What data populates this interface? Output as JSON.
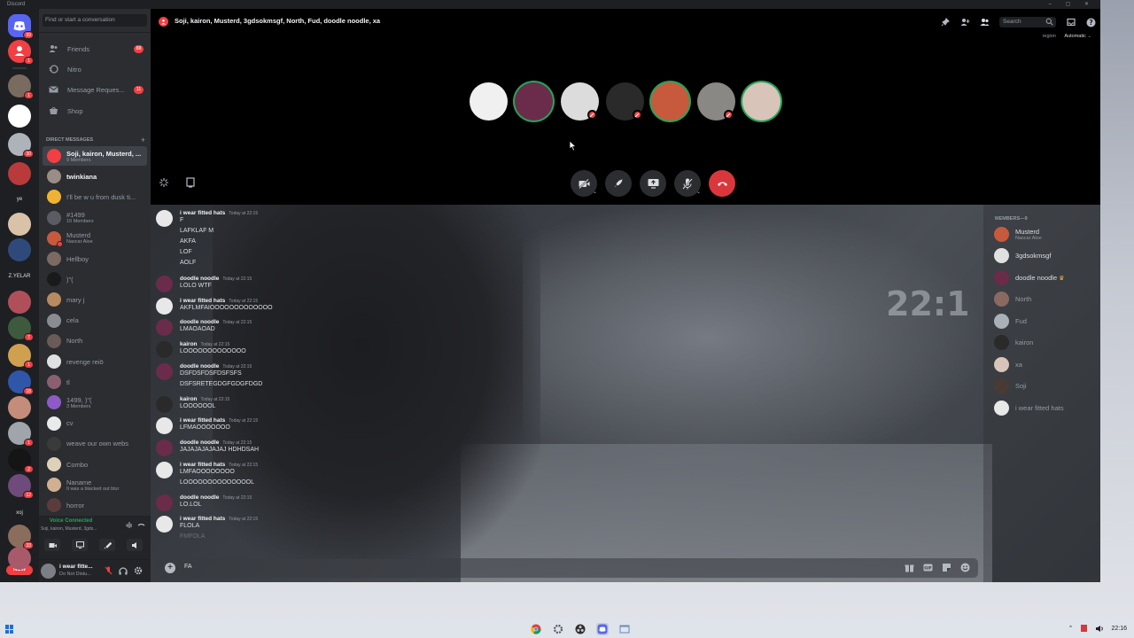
{
  "app": {
    "title": "Discord"
  },
  "rail": {
    "home_badge": "99",
    "dm_badge": "1",
    "items": [
      {
        "label": "",
        "color": "#7a6b60",
        "badge": "1"
      },
      {
        "label": "",
        "color": "#ffffff",
        "badge": ""
      },
      {
        "label": "",
        "color": "#aeb3ba",
        "badge": "30"
      },
      {
        "label": "",
        "color": "#b83a3a",
        "badge": ""
      },
      {
        "label": "ye",
        "color": "#2b2d31",
        "badge": ""
      },
      {
        "label": "",
        "color": "#d9c2a8",
        "badge": ""
      },
      {
        "label": "",
        "color": "#2f4a7a",
        "badge": ""
      },
      {
        "label": "Z.YELAR",
        "color": "#2b2d31",
        "badge": ""
      },
      {
        "label": "",
        "color": "#b04f5a",
        "badge": ""
      },
      {
        "label": "",
        "color": "#3d5a3d",
        "badge": "7"
      },
      {
        "label": "",
        "color": "#cfa050",
        "badge": "1"
      },
      {
        "label": "",
        "color": "#2f56a8",
        "badge": "18"
      },
      {
        "label": "",
        "color": "#c48c7a",
        "badge": ""
      },
      {
        "label": "",
        "color": "#a0a4ab",
        "badge": "1"
      },
      {
        "label": "",
        "color": "#151515",
        "badge": "2"
      },
      {
        "label": "",
        "color": "#6e4b7a",
        "badge": "12"
      },
      {
        "label": "xoj",
        "color": "#2b2d31",
        "badge": ""
      },
      {
        "label": "",
        "color": "#8b6d5e",
        "badge": "33"
      },
      {
        "label": "",
        "color": "#a85a6a",
        "badge": ""
      }
    ],
    "new_label": "NEW"
  },
  "dm": {
    "search_placeholder": "Find or start a conversation",
    "nav": [
      {
        "label": "Friends",
        "icon": "friends-icon",
        "badge": "88"
      },
      {
        "label": "Nitro",
        "icon": "nitro-icon",
        "badge": ""
      },
      {
        "label": "Message Reques...",
        "icon": "message-requests-icon",
        "badge": "11"
      },
      {
        "label": "Shop",
        "icon": "shop-icon",
        "badge": ""
      }
    ],
    "header": "DIRECT MESSAGES",
    "items": [
      {
        "name": "Soji, kairon, Musterd, ...",
        "sub": "9 Members",
        "color": "#f23f43",
        "active": true,
        "status": ""
      },
      {
        "name": "twinkiana",
        "sub": "",
        "color": "#9a8d86",
        "bright": true,
        "status": ""
      },
      {
        "name": "I'll be w u from dusk ti...",
        "sub": "",
        "color": "#f0b232",
        "status": ""
      },
      {
        "name": "#1499",
        "sub": "10 Members",
        "color": "#5a5c63",
        "status": ""
      },
      {
        "name": "Musterd",
        "sub": "Nascar Aloe",
        "color": "#c75a3c",
        "status": "#f23f43"
      },
      {
        "name": "Hellboy",
        "sub": "",
        "color": "#7a6a62",
        "status": ""
      },
      {
        "name": ")\"(",
        "sub": "",
        "color": "#1a1a1a",
        "status": ""
      },
      {
        "name": "mary j",
        "sub": "",
        "color": "#b88a60",
        "status": ""
      },
      {
        "name": "cela",
        "sub": "",
        "color": "#8a8c93",
        "status": ""
      },
      {
        "name": "North",
        "sub": "",
        "color": "#6a5a58",
        "status": ""
      },
      {
        "name": "revenge reiō",
        "sub": "",
        "color": "#e0e0e0",
        "status": ""
      },
      {
        "name": "tl",
        "sub": "",
        "color": "#8a6070",
        "status": ""
      },
      {
        "name": "1499, )\"(",
        "sub": "3 Members",
        "color": "#8e5ac8",
        "status": ""
      },
      {
        "name": "cv",
        "sub": "",
        "color": "#eaeaea",
        "status": ""
      },
      {
        "name": "weave our own webs",
        "sub": "",
        "color": "#3a3a3a",
        "status": ""
      },
      {
        "name": "Combo",
        "sub": "",
        "color": "#ddd2b8",
        "status": ""
      },
      {
        "name": "Naname",
        "sub": "It was a blacked out blur",
        "color": "#d0b090",
        "status": ""
      },
      {
        "name": "horror",
        "sub": "",
        "color": "#5a3c3c",
        "status": ""
      }
    ],
    "voice": {
      "status": "Voice Connected",
      "channel": "Soji, kairon, Musterd, 3gds..."
    },
    "user": {
      "name": "i wear fitte...",
      "status": "Do Not Distu..."
    }
  },
  "main": {
    "title": "Soji, kairon, Musterd, 3gdsokmsgf, North, Fud, doodle noodle, xa",
    "search_placeholder": "Search",
    "region_label": "region",
    "region_value": "Automatic",
    "call_avatars": [
      {
        "name": "i wear fitted hats",
        "color": "#f0f0f0",
        "muted": false,
        "speaking": false
      },
      {
        "name": "doodle noodle",
        "color": "#6a2c4a",
        "muted": false,
        "speaking": true
      },
      {
        "name": "3gdsokmsgf",
        "color": "#dcdcdc",
        "muted": true,
        "speaking": false
      },
      {
        "name": "kairon",
        "color": "#2a2a2a",
        "muted": true,
        "speaking": false
      },
      {
        "name": "Musterd",
        "color": "#c75a3c",
        "muted": false,
        "speaking": true
      },
      {
        "name": "North",
        "color": "#8a8884",
        "muted": true,
        "speaking": false
      },
      {
        "name": "xa",
        "color": "#d8c4b8",
        "muted": false,
        "speaking": true
      }
    ],
    "members_header": "MEMBERS—9",
    "members": [
      {
        "name": "Musterd",
        "sub": "Nascar Aloe",
        "color": "#c75a3c",
        "crown": false
      },
      {
        "name": "3gdsokmsgf",
        "sub": "",
        "color": "#e0e0e0",
        "crown": false
      },
      {
        "name": "doodle noodle",
        "sub": "",
        "color": "#6a2c4a",
        "crown": true
      },
      {
        "name": "North",
        "sub": "",
        "color": "#8a6a60",
        "crown": false
      },
      {
        "name": "Fud",
        "sub": "",
        "color": "#aab0b8",
        "crown": false
      },
      {
        "name": "kairon",
        "sub": "",
        "color": "#2a2a2a",
        "crown": false
      },
      {
        "name": "xa",
        "sub": "",
        "color": "#d8c4b8",
        "crown": false
      },
      {
        "name": "Soji",
        "sub": "",
        "color": "#4a3a34",
        "crown": false
      },
      {
        "name": "i wear fitted hats",
        "sub": "",
        "color": "#e8e8e8",
        "crown": false
      }
    ],
    "clock_watermark": "22:1",
    "messages": [
      {
        "author": "i wear fitted hats",
        "time": "Today at 22:15",
        "color": "#e8e8e8",
        "lines": [
          "F",
          "LAFKLAF M",
          "AKFA",
          "LOF",
          "AOLF"
        ]
      },
      {
        "author": "doodle noodle",
        "time": "Today at 22:15",
        "color": "#6a2c4a",
        "lines": [
          "LOLO WTF"
        ]
      },
      {
        "author": "i wear fitted hats",
        "time": "Today at 22:15",
        "color": "#e8e8e8",
        "lines": [
          "AKFLMFAIOOOOOOOOOOOOO"
        ]
      },
      {
        "author": "doodle noodle",
        "time": "Today at 22:15",
        "color": "#6a2c4a",
        "lines": [
          "LMAOAOAD"
        ]
      },
      {
        "author": "kairon",
        "time": "Today at 22:15",
        "color": "#2a2a2a",
        "lines": [
          "LOOOOOOOOOOOOO"
        ]
      },
      {
        "author": "doodle noodle",
        "time": "Today at 22:15",
        "color": "#6a2c4a",
        "lines": [
          "DSFDSFDSFDSFSFS",
          "DSFSRETEGDGFGDGFDGD"
        ]
      },
      {
        "author": "kairon",
        "time": "Today at 22:15",
        "color": "#2a2a2a",
        "lines": [
          "LOOOOOOL"
        ]
      },
      {
        "author": "i wear fitted hats",
        "time": "Today at 22:15",
        "color": "#e8e8e8",
        "lines": [
          "LFMAOOOOOOO"
        ]
      },
      {
        "author": "doodle noodle",
        "time": "Today at 22:15",
        "color": "#6a2c4a",
        "lines": [
          "JAJAJAJAJAJAJ HDHDSAH"
        ]
      },
      {
        "author": "i wear fitted hats",
        "time": "Today at 22:15",
        "color": "#e8e8e8",
        "lines": [
          "LMFAOOOOOOOO",
          "LOOOOOOOOOOOOOOL"
        ]
      },
      {
        "author": "doodle noodle",
        "time": "Today at 22:15",
        "color": "#6a2c4a",
        "lines": [
          "LO.LOL"
        ]
      },
      {
        "author": "i wear fitted hats",
        "time": "Today at 22:15",
        "color": "#e8e8e8",
        "lines": [
          "FLOLA",
          "FMFOLA"
        ]
      }
    ],
    "composer_value": "FA"
  },
  "taskbar": {
    "time": "22:16"
  }
}
